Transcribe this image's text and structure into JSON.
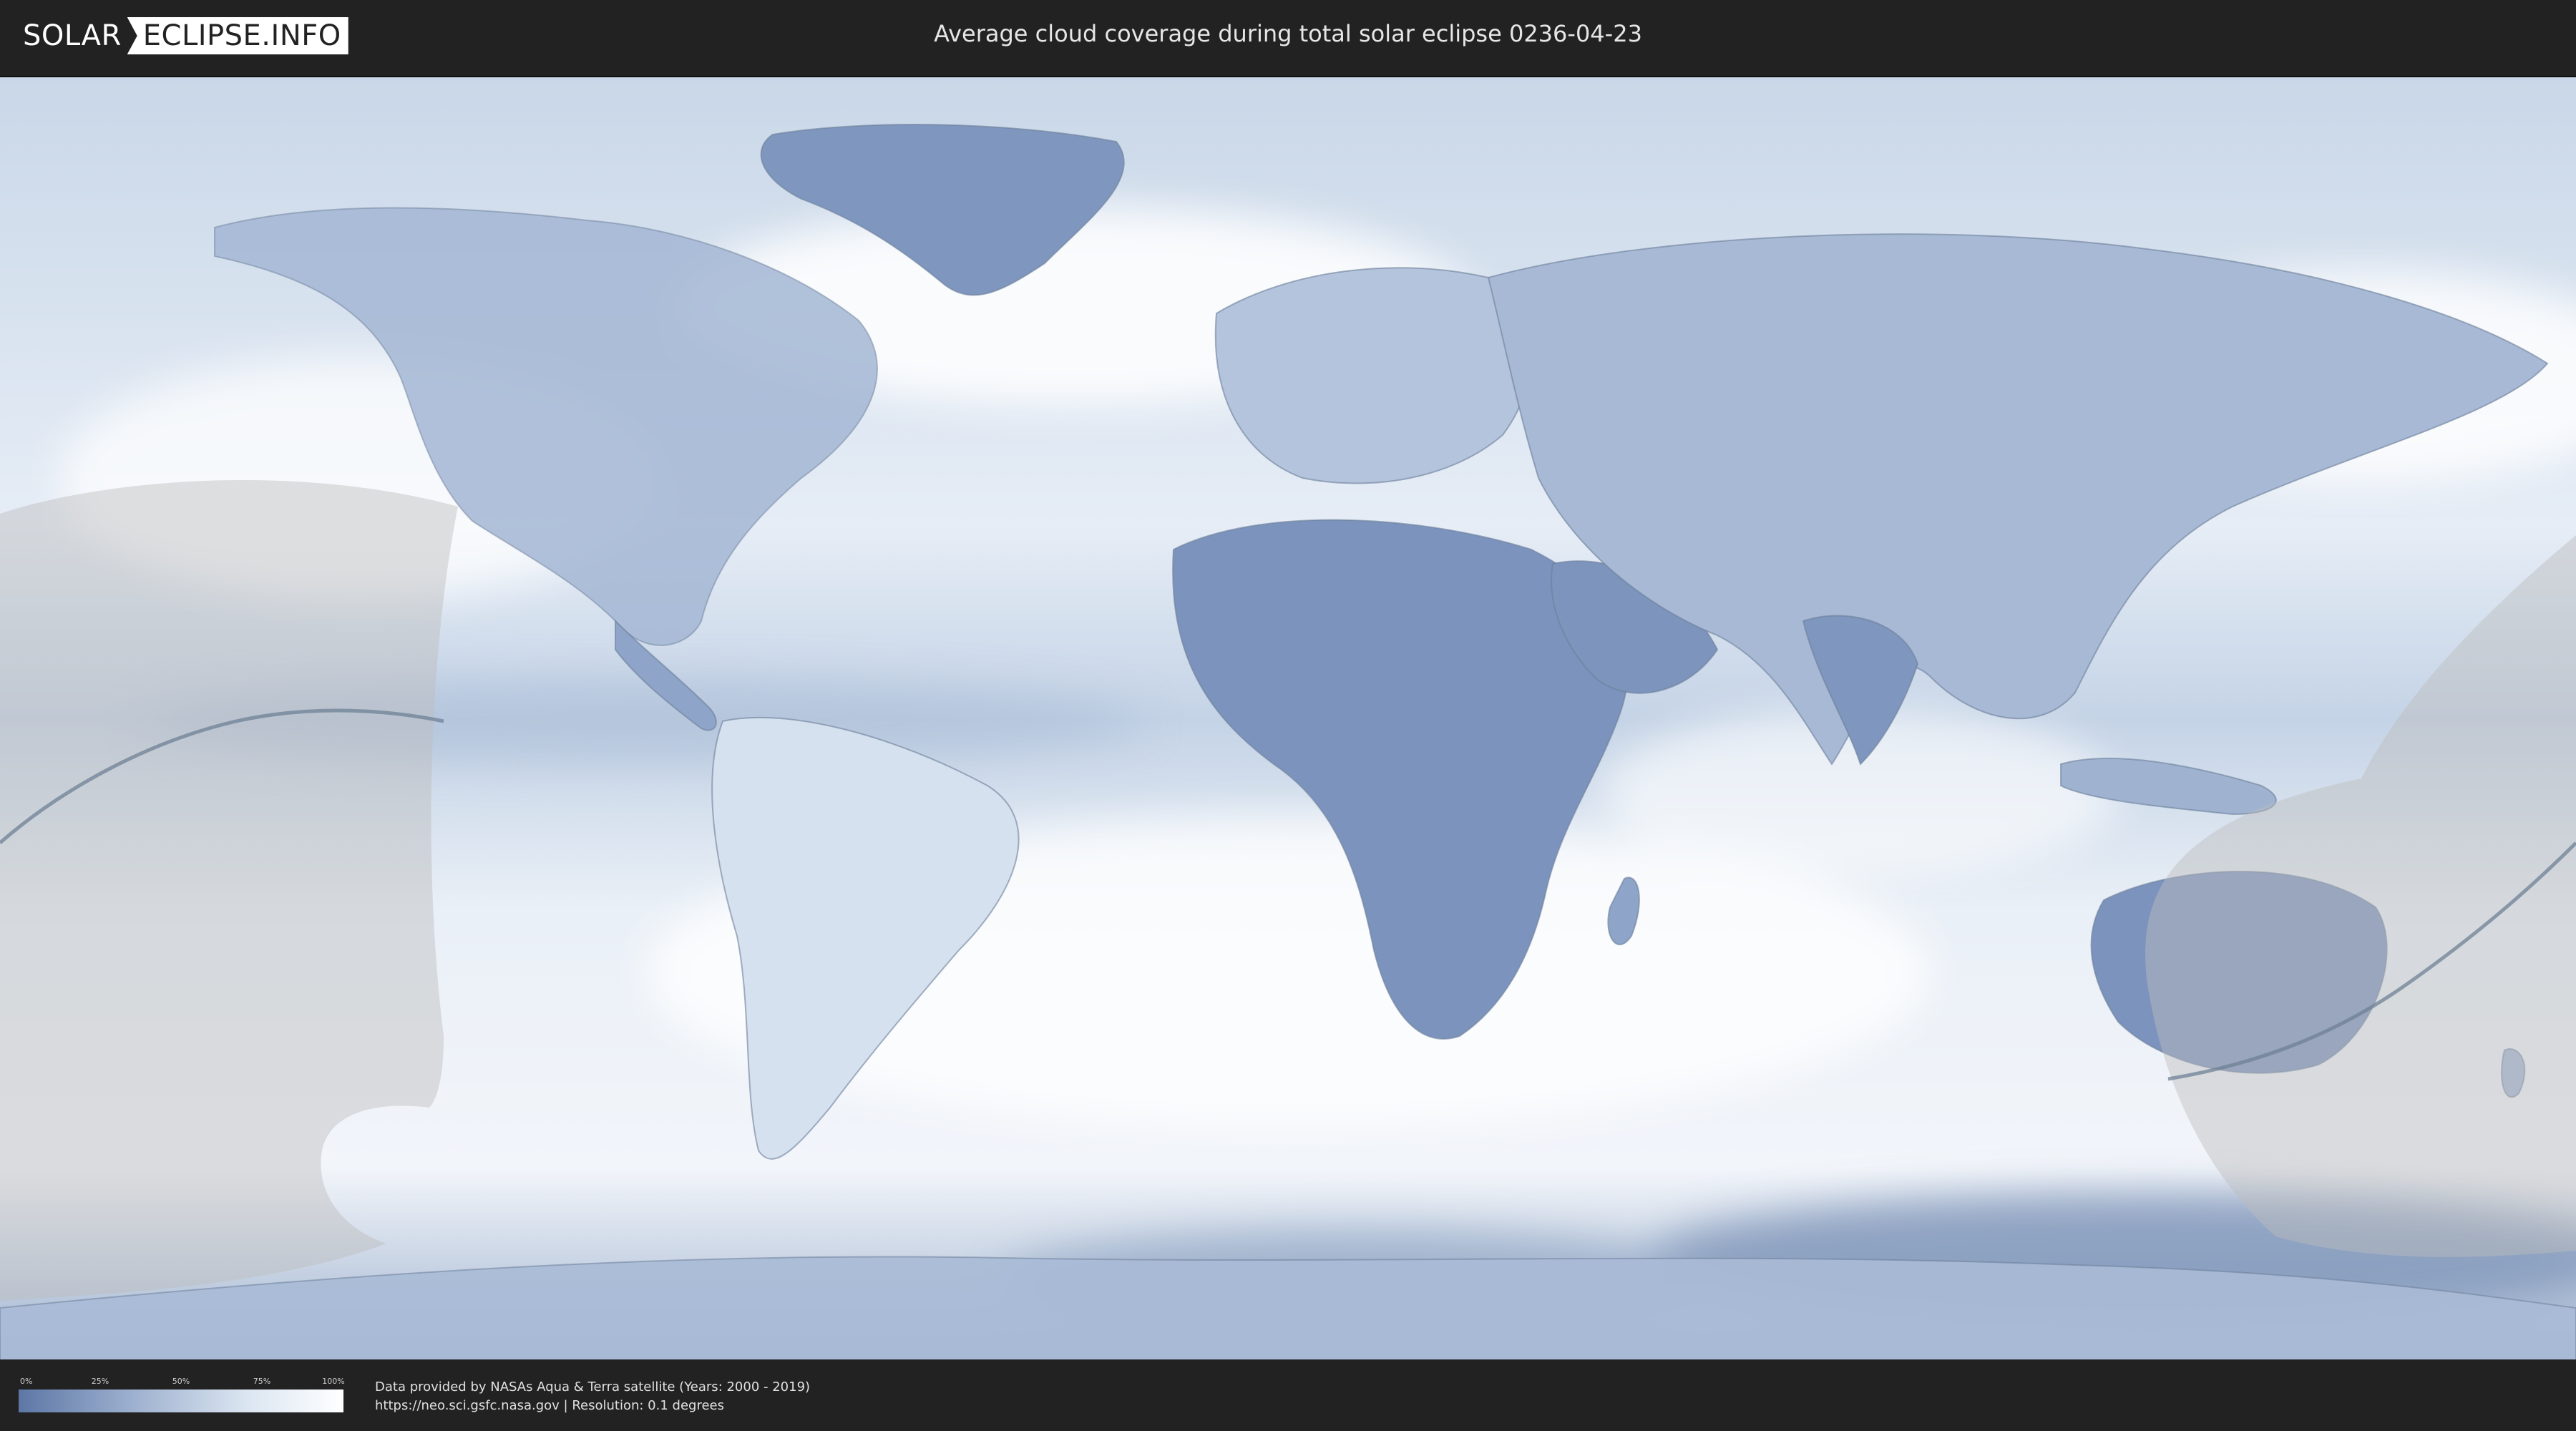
{
  "header": {
    "logo_left": "SOLAR",
    "logo_right": "ECLIPSE.INFO",
    "title": "Average cloud coverage during total solar eclipse 0236-04-23"
  },
  "map": {
    "layer": "average-cloud-coverage",
    "colors": {
      "clear": "#5d77a6",
      "cloudy": "#ffffff",
      "night_shade": "#c8c8c8",
      "eclipse_path": "#6f8296"
    }
  },
  "legend": {
    "ticks": [
      "0%",
      "25%",
      "50%",
      "75%",
      "100%"
    ]
  },
  "footer": {
    "credit_line1": "Data provided by NASAs Aqua & Terra satellite (Years: 2000 - 2019)",
    "credit_line2": "https://neo.sci.gsfc.nasa.gov | Resolution: 0.1 degrees"
  }
}
